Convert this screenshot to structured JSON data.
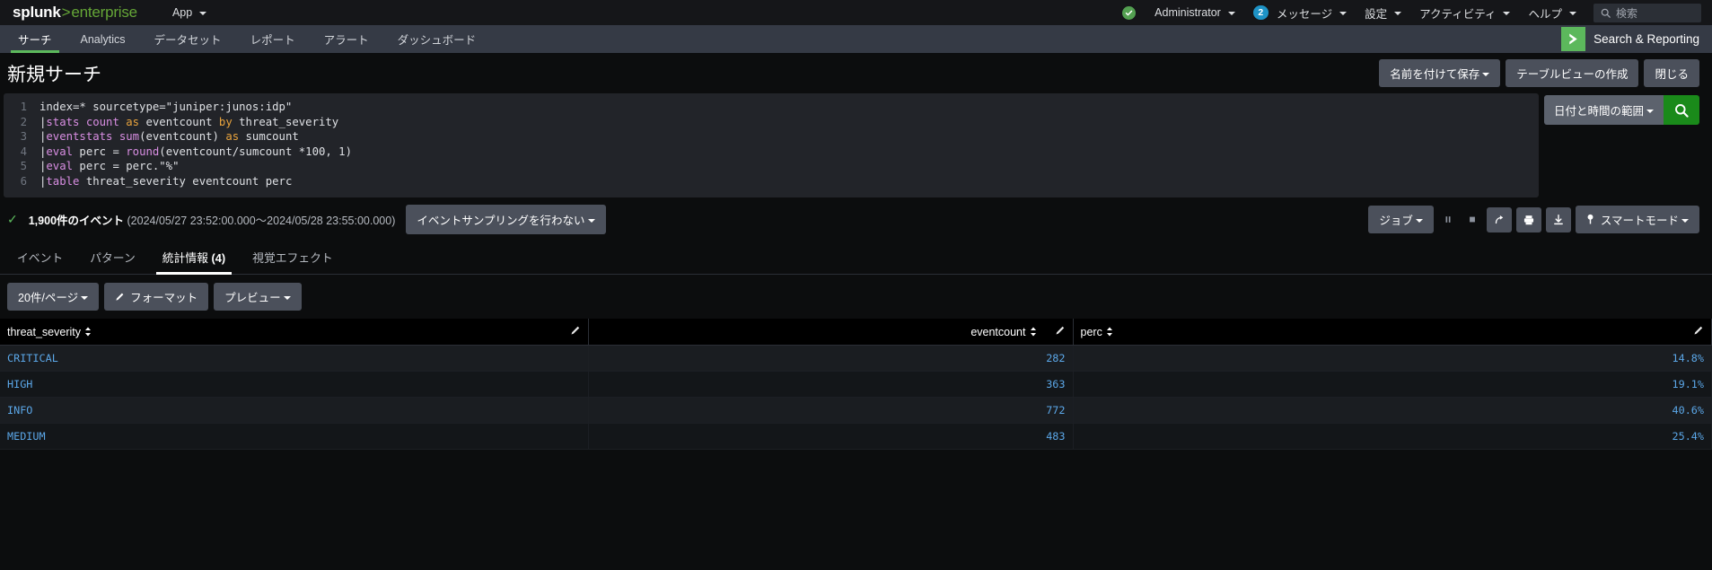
{
  "topbar": {
    "logo": {
      "brand": "splunk",
      "gt": ">",
      "product": "enterprise"
    },
    "app_menu": "App",
    "user": "Administrator",
    "messages_label": "メッセージ",
    "messages_count": "2",
    "settings": "設定",
    "activity": "アクティビティ",
    "help": "ヘルプ",
    "search_placeholder": "検索"
  },
  "nav": {
    "items": [
      {
        "label": "サーチ",
        "active": true
      },
      {
        "label": "Analytics",
        "active": false
      },
      {
        "label": "データセット",
        "active": false
      },
      {
        "label": "レポート",
        "active": false
      },
      {
        "label": "アラート",
        "active": false
      },
      {
        "label": "ダッシュボード",
        "active": false
      }
    ],
    "app_name": "Search & Reporting"
  },
  "page": {
    "title": "新規サーチ",
    "actions": {
      "save_as": "名前を付けて保存",
      "create_table_view": "テーブルビューの作成",
      "close": "閉じる"
    }
  },
  "search": {
    "lines": [
      {
        "n": "1",
        "tokens": [
          {
            "t": "txt",
            "v": "index=* sourcetype=\"juniper:junos:idp\""
          }
        ]
      },
      {
        "n": "2",
        "tokens": [
          {
            "t": "pipe",
            "v": "|"
          },
          {
            "t": "cmd",
            "v": "stats "
          },
          {
            "t": "fn",
            "v": "count"
          },
          {
            "t": "txt",
            "v": " "
          },
          {
            "t": "kw",
            "v": "as"
          },
          {
            "t": "txt",
            "v": " eventcount "
          },
          {
            "t": "kw",
            "v": "by"
          },
          {
            "t": "txt",
            "v": " threat_severity"
          }
        ]
      },
      {
        "n": "3",
        "tokens": [
          {
            "t": "pipe",
            "v": "|"
          },
          {
            "t": "cmd",
            "v": "eventstats "
          },
          {
            "t": "fn",
            "v": "sum"
          },
          {
            "t": "txt",
            "v": "(eventcount) "
          },
          {
            "t": "kw",
            "v": "as"
          },
          {
            "t": "txt",
            "v": " sumcount"
          }
        ]
      },
      {
        "n": "4",
        "tokens": [
          {
            "t": "pipe",
            "v": "|"
          },
          {
            "t": "cmd",
            "v": "eval"
          },
          {
            "t": "txt",
            "v": " perc = "
          },
          {
            "t": "fn",
            "v": "round"
          },
          {
            "t": "txt",
            "v": "(eventcount/sumcount *100, 1)"
          }
        ]
      },
      {
        "n": "5",
        "tokens": [
          {
            "t": "pipe",
            "v": "|"
          },
          {
            "t": "cmd",
            "v": "eval"
          },
          {
            "t": "txt",
            "v": " perc = perc.\"%\""
          }
        ]
      },
      {
        "n": "6",
        "tokens": [
          {
            "t": "pipe",
            "v": "|"
          },
          {
            "t": "cmd",
            "v": "table"
          },
          {
            "t": "txt",
            "v": " threat_severity eventcount perc"
          }
        ]
      }
    ],
    "date_range": "日付と時間の範囲",
    "run_icon": "search-icon"
  },
  "results_bar": {
    "event_count": "1,900件のイベント",
    "time_range": "(2024/05/27 23:52:00.000〜2024/05/28 23:55:00.000)",
    "sampling": "イベントサンプリングを行わない",
    "job": "ジョブ",
    "mode": "スマートモード"
  },
  "result_tabs": [
    {
      "label": "イベント",
      "count": "",
      "active": false
    },
    {
      "label": "パターン",
      "count": "",
      "active": false
    },
    {
      "label": "統計情報",
      "count": "(4)",
      "active": true
    },
    {
      "label": "視覚エフェクト",
      "count": "",
      "active": false
    }
  ],
  "table_toolbar": {
    "per_page": "20件/ページ",
    "format": "フォーマット",
    "preview": "プレビュー"
  },
  "table": {
    "columns": [
      {
        "name": "threat_severity",
        "align": "left"
      },
      {
        "name": "eventcount",
        "align": "right"
      },
      {
        "name": "perc",
        "align": "right"
      }
    ],
    "rows": [
      {
        "threat_severity": "CRITICAL",
        "eventcount": "282",
        "perc": "14.8%"
      },
      {
        "threat_severity": "HIGH",
        "eventcount": "363",
        "perc": "19.1%"
      },
      {
        "threat_severity": "INFO",
        "eventcount": "772",
        "perc": "40.6%"
      },
      {
        "threat_severity": "MEDIUM",
        "eventcount": "483",
        "perc": "25.4%"
      }
    ]
  },
  "colors": {
    "accent_green": "#5cb85c",
    "link_blue": "#5ba7e8",
    "badge_blue": "#1e93c6",
    "run_green": "#1a8a1a"
  }
}
